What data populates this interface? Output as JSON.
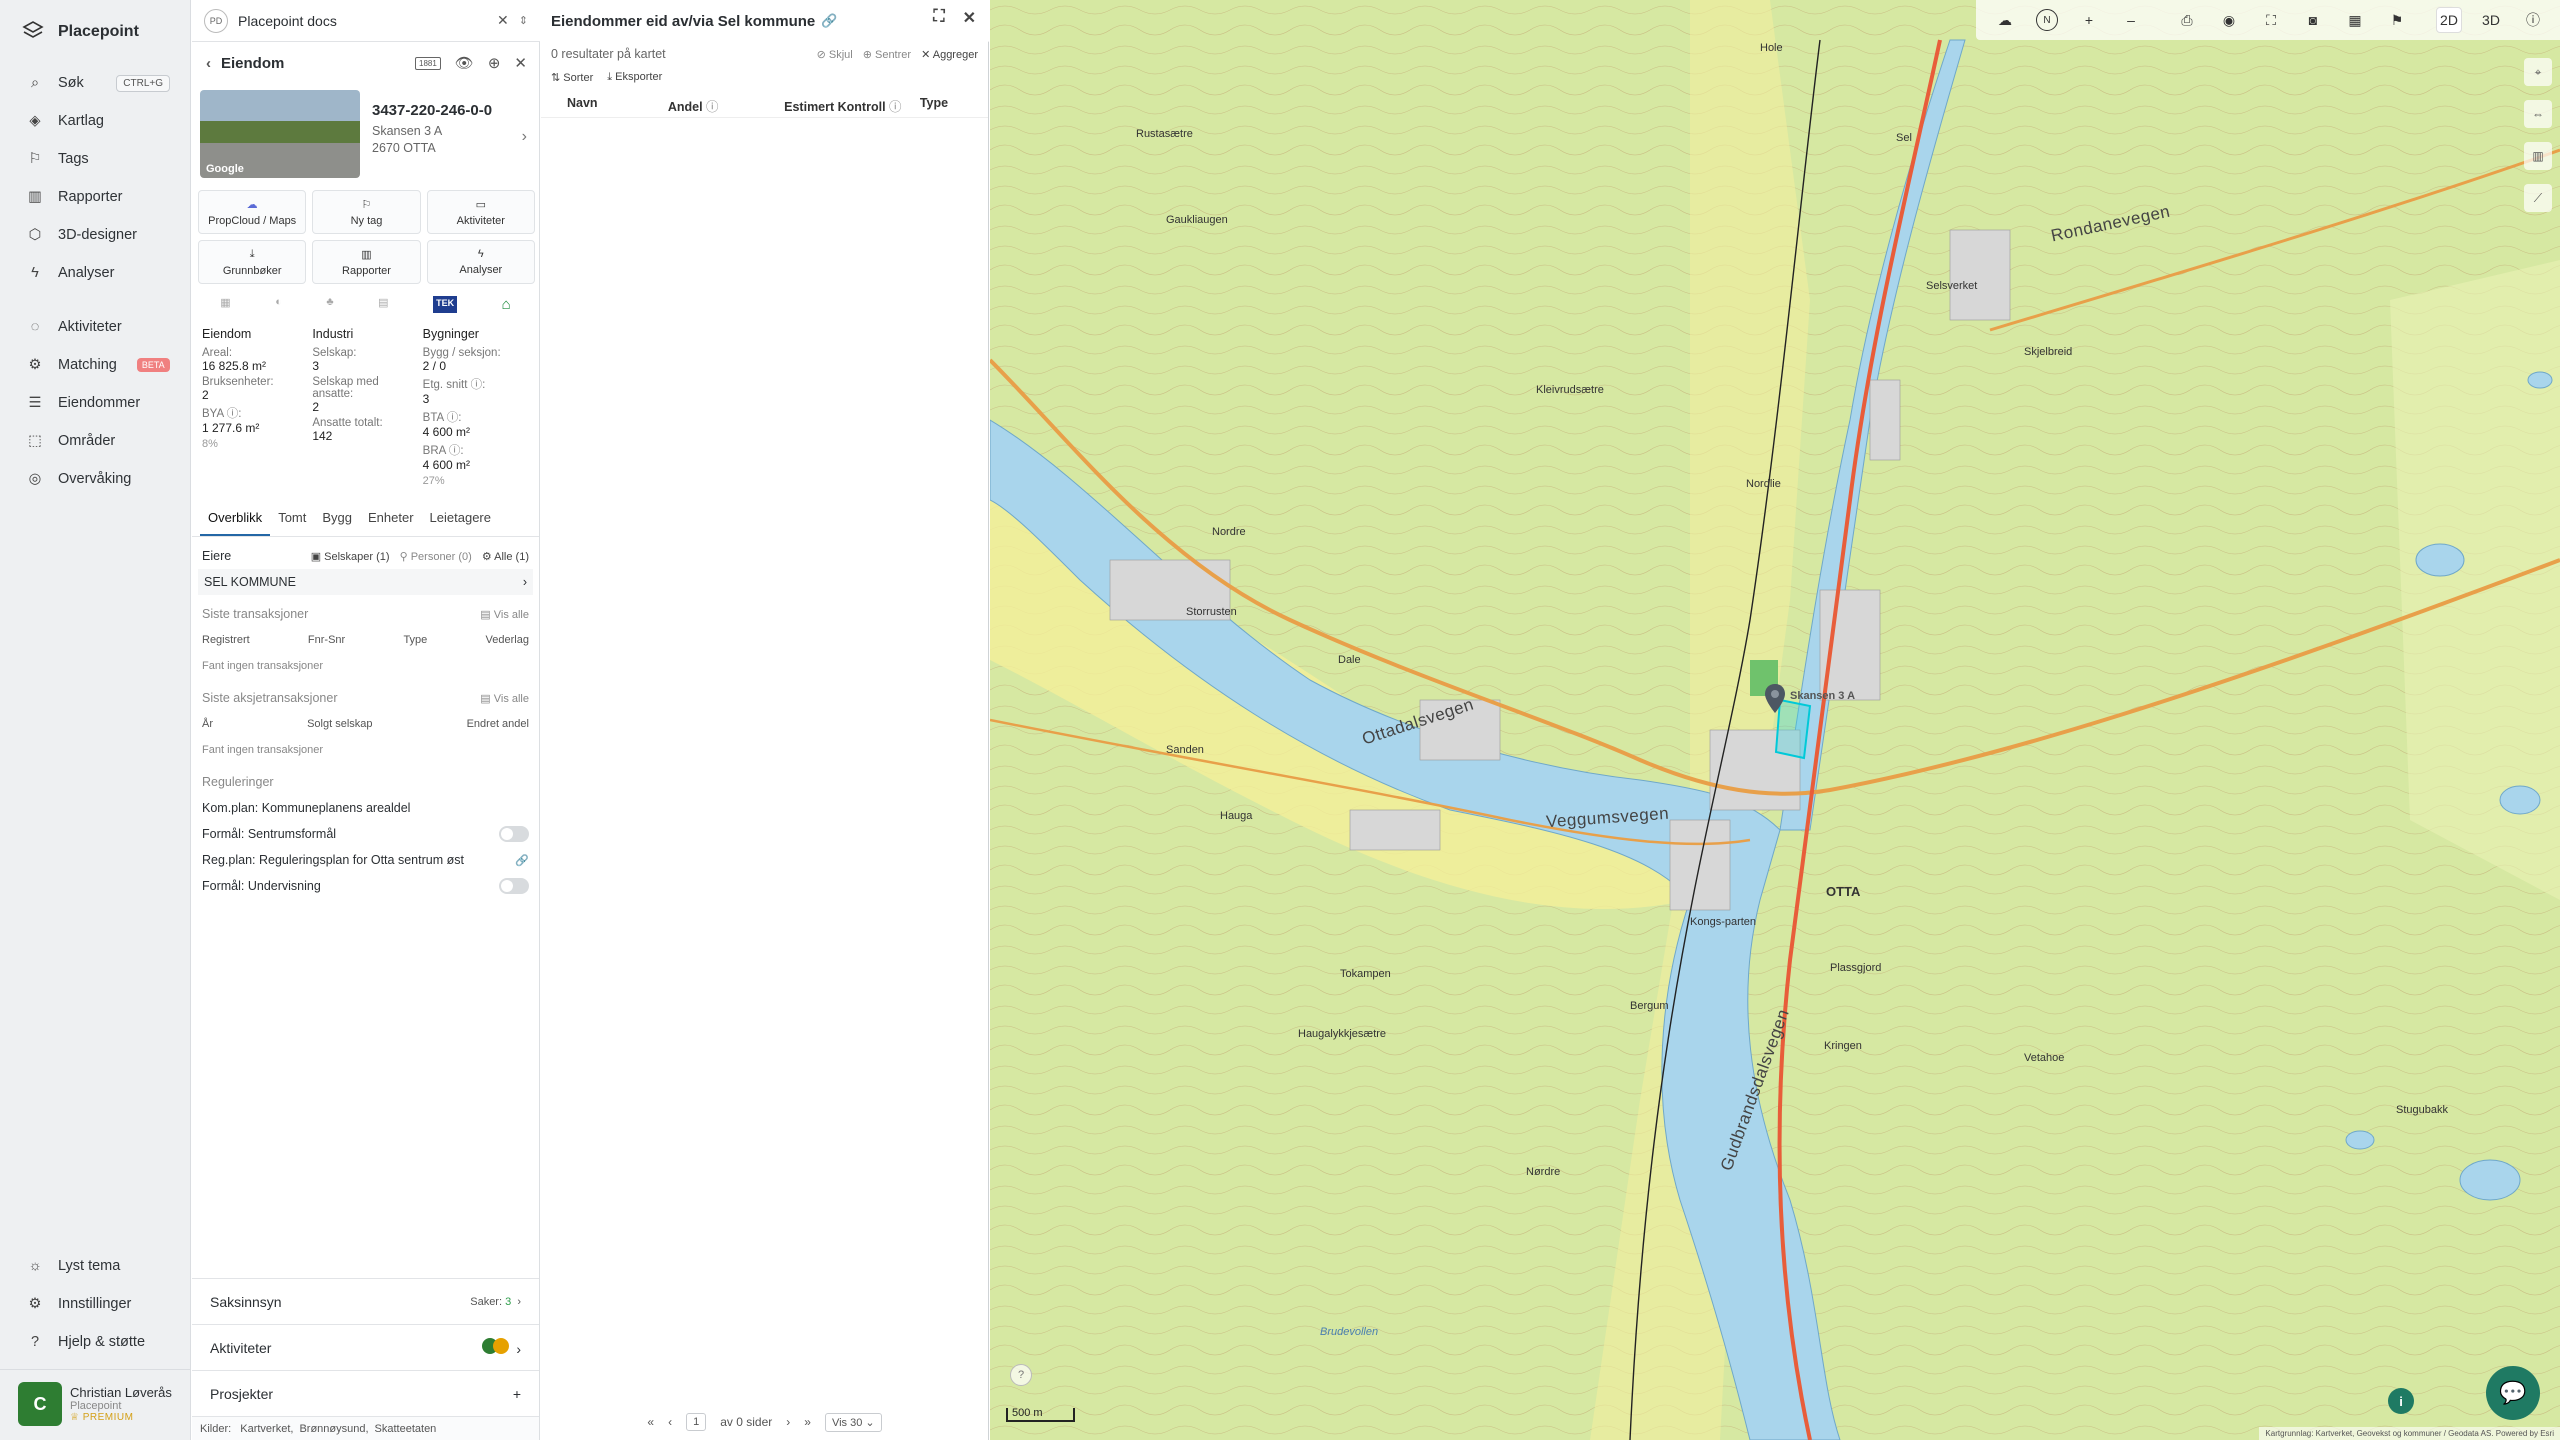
{
  "app": {
    "name": "Placepoint",
    "docs_title": "Placepoint docs",
    "docs_badge": "PD"
  },
  "nav": {
    "items": [
      {
        "label": "Søk",
        "kbd": "CTRL+G",
        "icon": "search-icon"
      },
      {
        "label": "Kartlag",
        "icon": "layers-icon"
      },
      {
        "label": "Tags",
        "icon": "bookmark-icon"
      },
      {
        "label": "Rapporter",
        "icon": "chart-icon"
      },
      {
        "label": "3D-designer",
        "icon": "cube-icon"
      },
      {
        "label": "Analyser",
        "icon": "bolt-icon"
      }
    ],
    "items2": [
      {
        "label": "Aktiviteter",
        "icon": "chat-icon"
      },
      {
        "label": "Matching",
        "badge": "BETA",
        "icon": "matching-icon"
      },
      {
        "label": "Eiendommer",
        "icon": "list-icon"
      },
      {
        "label": "Områder",
        "icon": "area-icon"
      },
      {
        "label": "Overvåking",
        "icon": "monitor-icon"
      }
    ],
    "bottom": [
      {
        "label": "Lyst tema",
        "icon": "sun-icon"
      },
      {
        "label": "Innstillinger",
        "icon": "gear-icon"
      },
      {
        "label": "Hjelp & støtte",
        "icon": "help-icon"
      }
    ],
    "user": {
      "initial": "C",
      "name": "Christian Løverås",
      "org": "Placepoint",
      "tier": "PREMIUM"
    }
  },
  "property": {
    "header": "Eiendom",
    "header_badge": "1881",
    "id": "3437-220-246-0-0",
    "address1": "Skansen 3 A",
    "address2": "2670 OTTA",
    "photo_credit": "Google",
    "actions": [
      "PropCloud / Maps",
      "Ny tag",
      "Aktiviteter",
      "Grunnbøker",
      "Rapporter",
      "Analyser"
    ],
    "badge_tek": "TEK",
    "col1": {
      "title": "Eiendom",
      "areal_l": "Areal:",
      "areal_v": "16 825.8 m²",
      "bruk_l": "Bruksenheter:",
      "bruk_v": "2",
      "bya_l": "BYA ⓘ:",
      "bya_v": "1 277.6 m²",
      "bya_p": "8%"
    },
    "col2": {
      "title": "Industri",
      "selskap_l": "Selskap:",
      "selskap_v": "3",
      "ansatte_l": "Selskap med ansatte:",
      "ansatte_v": "2",
      "tot_l": "Ansatte totalt:",
      "tot_v": "142"
    },
    "col3": {
      "title": "Bygninger",
      "bygg_l": "Bygg / seksjon:",
      "bygg_v": "2 / 0",
      "etg_l": "Etg. snitt ⓘ:",
      "etg_v": "3",
      "bta_l": "BTA ⓘ:",
      "bta_v": "4 600 m²",
      "bra_l": "BRA ⓘ:",
      "bra_v": "4 600 m²",
      "bra_p": "27%"
    },
    "tabs": [
      "Overblikk",
      "Tomt",
      "Bygg",
      "Enheter",
      "Leietagere"
    ],
    "owners_label": "Eiere",
    "filter_selskaper": "Selskaper (1)",
    "filter_personer": "Personer (0)",
    "filter_alle": "Alle (1)",
    "owner": "SEL KOMMUNE",
    "tx_title": "Siste transaksjoner",
    "vis_alle": "Vis alle",
    "tx_cols": [
      "Registrert",
      "Fnr-Snr",
      "Type",
      "Vederlag"
    ],
    "tx_empty": "Fant ingen transaksjoner",
    "stx_title": "Siste aksjetransaksjoner",
    "stx_cols": [
      "År",
      "Solgt selskap",
      "Endret andel"
    ],
    "stx_empty": "Fant ingen transaksjoner",
    "reg_title": "Reguleringer",
    "reg": [
      "Kom.plan: Kommuneplanens arealdel",
      "Formål: Sentrumsformål",
      "Reg.plan: Reguleringsplan for Otta sentrum øst",
      "Formål: Undervisning"
    ],
    "saksinnsyn": "Saksinnsyn",
    "saker_label": "Saker:",
    "saker_count": "3",
    "aktiviteter": "Aktiviteter",
    "prosjekter": "Prosjekter",
    "sources_label": "Kilder:",
    "sources": [
      "Kartverket,",
      "Brønnøysund,",
      "Skatteetaten"
    ]
  },
  "results": {
    "title": "Eiendommer eid av/via Sel kommune",
    "count": "0 resultater på kartet",
    "skjul": "Skjul",
    "sentrer": "Sentrer",
    "aggreger": "Aggreger",
    "sorter": "Sorter",
    "eksporter": "Eksporter",
    "cols": [
      "Navn",
      "Andel",
      "Estimert Kontroll",
      "Type"
    ],
    "page": "1",
    "of_pages": "av 0 sider",
    "per_page": "Vis 30"
  },
  "map": {
    "mode_2d": "2D",
    "mode_3d": "3D",
    "north": "N",
    "scale": "500 m",
    "attribution": "Kartgrunnlag: Kartverket, Geovekst og kommuner / Geodata AS. Powered by Esri",
    "pin_label": "Skansen 3 A",
    "labels": [
      "Rondanevegen",
      "Ottadalsvegen",
      "Veggumsvegen",
      "Gudbrandsdalsvegen",
      "OTTA",
      "Dale",
      "Sanden",
      "Nordre",
      "Sel",
      "Selsverket",
      "Kleivrudsætre",
      "Storrusten",
      "Hauga",
      "Tokampen",
      "Bergum",
      "Kongs-parten",
      "Rustasætre",
      "Gaukliaugen",
      "Brudevollen",
      "Plassgjord",
      "Kringen",
      "Vetahoe",
      "Stugubakk",
      "Skjelbreid",
      "Haugalykkjesætre",
      "Nordlie",
      "Hole",
      "Nørdre"
    ]
  }
}
